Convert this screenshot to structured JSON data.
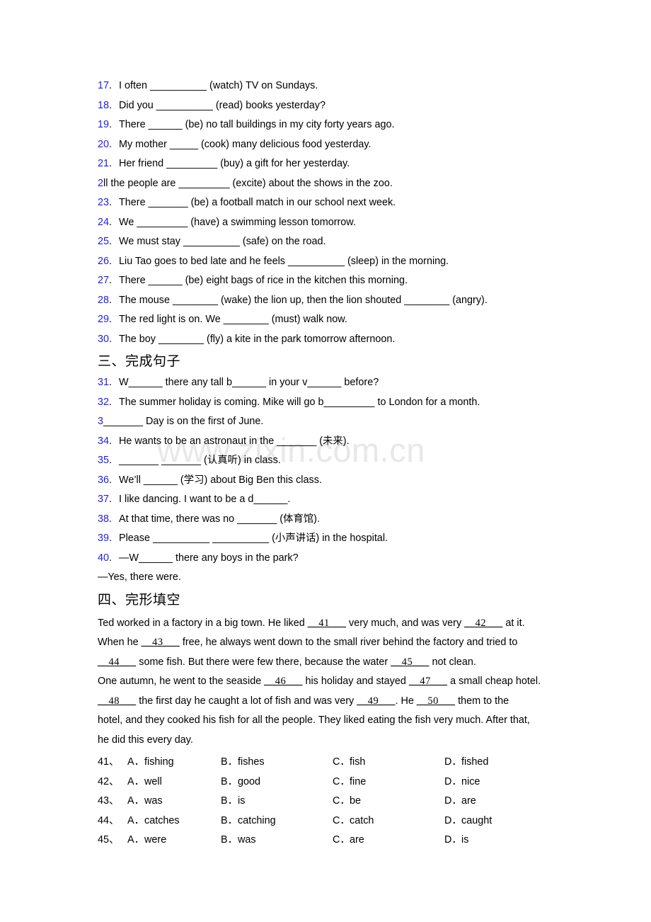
{
  "watermark": {
    "text": "www.zixin.com.cn"
  },
  "section_two_items": [
    {
      "num": "17",
      "text": "I often __________ (watch) TV on Sundays."
    },
    {
      "num": "18",
      "text": "Did you __________ (read) books yesterday?"
    },
    {
      "num": "19",
      "text": "There ______ (be) no tall buildings in my city forty years ago."
    },
    {
      "num": "20",
      "text": "My mother _____ (cook) many delicious food yesterday."
    },
    {
      "num": "21",
      "text": "Her friend _________ (buy) a gift for her yesterday."
    },
    {
      "num": "23",
      "text": "There _______ (be) a football match in our school next week."
    },
    {
      "num": "24",
      "text": "We _________ (have) a swimming lesson tomorrow."
    },
    {
      "num": "25",
      "text": "We must stay __________ (safe) on the road."
    },
    {
      "num": "26",
      "text": "Liu Tao goes to bed late and he feels __________ (sleep) in the morning."
    },
    {
      "num": "27",
      "text": "There ______ (be) eight bags of rice in the kitchen this morning."
    },
    {
      "num": "28",
      "text": "The mouse ________ (wake) the lion up, then the lion shouted ________ (angry)."
    },
    {
      "num": "29",
      "text": "The red light is on. We ________ (must) walk now."
    },
    {
      "num": "30",
      "text": "The boy ________ (fly) a kite in the park tomorrow afternoon."
    }
  ],
  "item_22": {
    "num_prefix": "2",
    "rest": "ll the people are _________ (excite) about the shows in the zoo."
  },
  "section_three": {
    "heading": "三、完成句子",
    "items": [
      {
        "num": "31",
        "text": "W______ there any tall b______ in your v______ before?"
      },
      {
        "num": "32",
        "text": "The summer holiday is coming. Mike will go b_________ to London for a month."
      },
      {
        "num": "34",
        "text": "He wants to be an astronaut in the _______ (未来)."
      },
      {
        "num": "35",
        "text": "_______ _______ (认真听) in class."
      },
      {
        "num": "36",
        "text": "We’ll ______ (学习) about Big Ben this class."
      },
      {
        "num": "37",
        "text": "I like dancing. I want to be a d______."
      },
      {
        "num": "38",
        "text": "At that time, there was no _______ (体育馆)."
      },
      {
        "num": "39",
        "text": "Please __________ __________ (小声讲话) in the hospital."
      },
      {
        "num": "40",
        "text": "—W______ there any boys in the park?"
      }
    ],
    "item_33": {
      "num_prefix": "3",
      "rest": "_______ Day is on the first of June."
    },
    "answer_line_40": "—Yes, there were."
  },
  "section_four": {
    "heading": "四、完形填空",
    "passage_lines": [
      [
        {
          "t": "Ted worked in a factory in a big town. He liked ",
          "b": false
        },
        {
          "t": "__41___",
          "b": true
        },
        {
          "t": " very much, and was very ",
          "b": false
        },
        {
          "t": "__42___",
          "b": true
        },
        {
          "t": " at it.",
          "b": false
        }
      ],
      [
        {
          "t": "When he ",
          "b": false
        },
        {
          "t": "__43___",
          "b": true
        },
        {
          "t": " free, he always went down to the small river behind the factory and tried to",
          "b": false
        }
      ],
      [
        {
          "t": "__44___",
          "b": true
        },
        {
          "t": " some fish. But there were few there, because the water ",
          "b": false
        },
        {
          "t": "__45___",
          "b": true
        },
        {
          "t": " not clean.",
          "b": false
        }
      ],
      [
        {
          "t": "One autumn, he went to the seaside ",
          "b": false
        },
        {
          "t": "__46___",
          "b": true
        },
        {
          "t": " his holiday and stayed ",
          "b": false
        },
        {
          "t": "__47___",
          "b": true
        },
        {
          "t": " a small cheap hotel.",
          "b": false
        }
      ],
      [
        {
          "t": "__48___",
          "b": true
        },
        {
          "t": " the first day he caught a lot of fish and was very ",
          "b": false
        },
        {
          "t": "__49___",
          "b": true
        },
        {
          "t": ". He ",
          "b": false
        },
        {
          "t": "__50___",
          "b": true
        },
        {
          "t": " them to the",
          "b": false
        }
      ],
      [
        {
          "t": "hotel, and they cooked his fish for all the people. They liked eating the fish very much. After that,",
          "b": false
        }
      ],
      [
        {
          "t": "he did this every day.",
          "b": false
        }
      ]
    ],
    "choices": [
      {
        "qn": "41、",
        "a": "fishing",
        "b": "fishes",
        "c": "fish",
        "d": "fished"
      },
      {
        "qn": "42、",
        "a": "well",
        "b": "good",
        "c": "fine",
        "d": "nice"
      },
      {
        "qn": "43、",
        "a": "was",
        "b": "is",
        "c": "be",
        "d": "are"
      },
      {
        "qn": "44、",
        "a": "catches",
        "b": "catching",
        "c": "catch",
        "d": "caught"
      },
      {
        "qn": "45、",
        "a": "were",
        "b": "was",
        "c": "are",
        "d": "is"
      }
    ],
    "option_labels": {
      "a": "A．",
      "b": "B．",
      "c": "C．",
      "d": "D．"
    }
  },
  "colors": {
    "number_blue": "#1f1fe0",
    "text_black": "#000000",
    "watermark_gray": "#e8e8e8",
    "page_background": "#ffffff"
  }
}
